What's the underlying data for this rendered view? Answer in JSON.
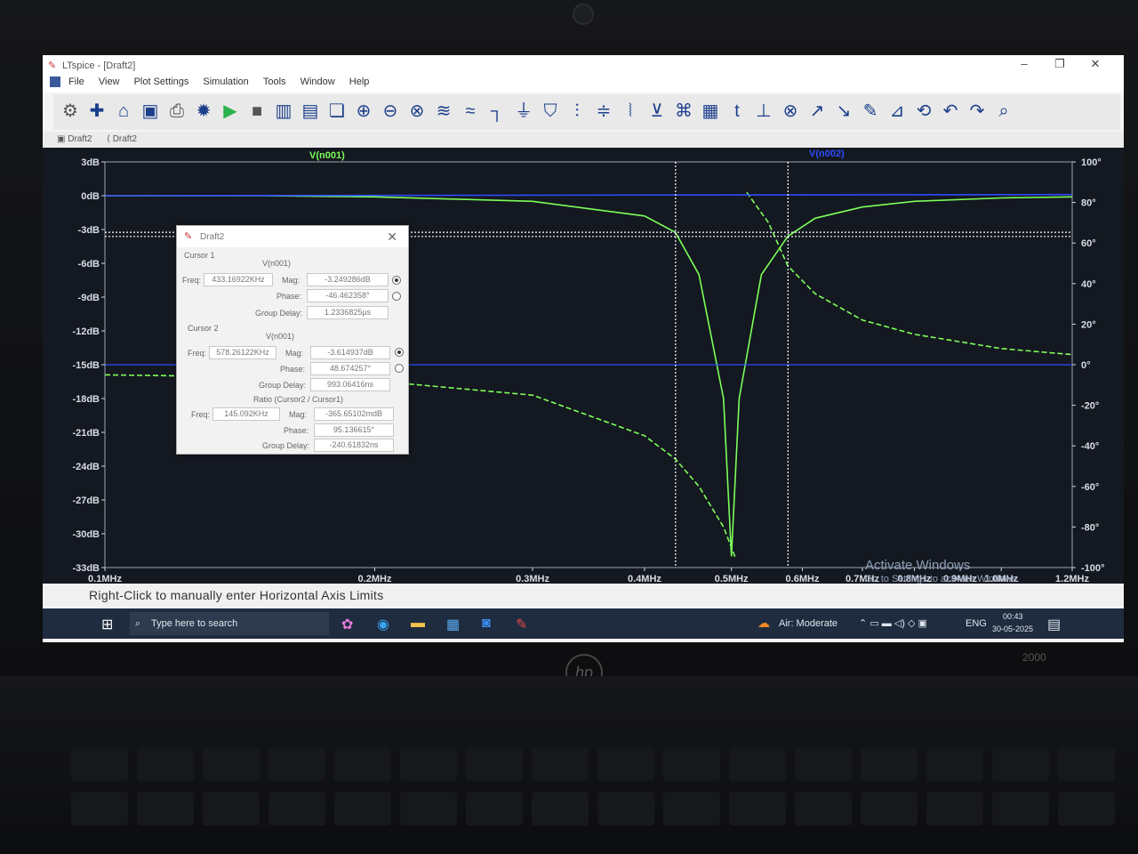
{
  "window": {
    "title": "LTspice - [Draft2]",
    "controls": [
      "–",
      "❐",
      "✕"
    ],
    "mdi_controls": [
      "–",
      "❐",
      "✕"
    ]
  },
  "menu": [
    "File",
    "View",
    "Plot Settings",
    "Simulation",
    "Tools",
    "Window",
    "Help"
  ],
  "toolbar_icons": [
    "settings-icon",
    "new-schematic-icon",
    "open-icon",
    "save-icon",
    "print-icon",
    "hierarchy-icon",
    "run-icon",
    "halt-icon",
    "tile-vertical-icon",
    "tile-horizontal-icon",
    "cascade-icon",
    "zoom-in-icon",
    "zoom-out-icon",
    "zoom-fit-icon",
    "autorange-icon",
    "scale-icon",
    "wire-icon",
    "ground-icon",
    "label-icon",
    "resistor-icon",
    "capacitor-icon",
    "inductor-icon",
    "diode-icon",
    "component-icon",
    "net-icon",
    "text-icon",
    "spice-directive-icon",
    "delete-icon",
    "move-icon",
    "drag-icon",
    "draw-icon",
    "mirror-icon",
    "rotate-icon",
    "undo-icon",
    "redo-icon",
    "find-icon"
  ],
  "tabs": [
    "Draft2",
    "Draft2"
  ],
  "plot": {
    "trace1_label": "V(n001)",
    "trace2_label": "V(n002)",
    "trace1_color": "#7cff5a",
    "trace2_color": "#2e4bff",
    "left_ticks": [
      "3dB",
      "0dB",
      "-3dB",
      "-6dB",
      "-9dB",
      "-12dB",
      "-15dB",
      "-18dB",
      "-21dB",
      "-24dB",
      "-27dB",
      "-30dB",
      "-33dB"
    ],
    "right_ticks": [
      "100°",
      "80°",
      "60°",
      "40°",
      "20°",
      "0°",
      "-20°",
      "-40°",
      "-60°",
      "-80°",
      "-100°"
    ],
    "x_ticks": [
      "0.1MHz",
      "0.2MHz",
      "0.3MHz",
      "0.4MHz",
      "0.5MHz",
      "0.6MHz",
      "0.7MHz",
      "0.8MHz",
      "0.9MHz",
      "1.0MHz",
      "1.2MHz"
    ],
    "watermark_title": "Activate Windows",
    "watermark_sub": "Go to Settings to activate Windows."
  },
  "chart_data": {
    "type": "line",
    "title": "",
    "xlabel": "",
    "ylabel": "",
    "x_scale": "log",
    "xlim_hz": [
      100000,
      1200000
    ],
    "ylim_db": [
      -33,
      3
    ],
    "y2lim_deg": [
      -100,
      100
    ],
    "series": [
      {
        "name": "V(n001)",
        "axis": "magnitude_db",
        "style": "solid",
        "x_hz": [
          100000,
          150000,
          200000,
          300000,
          400000,
          433000,
          460000,
          490000,
          500000,
          510000,
          540000,
          578000,
          620000,
          700000,
          800000,
          1000000,
          1200000
        ],
        "y": [
          0,
          0,
          -0.1,
          -0.5,
          -1.8,
          -3.25,
          -7,
          -18,
          -32,
          -18,
          -7,
          -3.6,
          -2,
          -1,
          -0.5,
          -0.2,
          -0.1
        ]
      },
      {
        "name": "V(n001)",
        "axis": "phase_deg",
        "style": "dashed",
        "x_hz": [
          100000,
          150000,
          200000,
          300000,
          400000,
          433000,
          460000,
          490000,
          505000,
          520000,
          550000,
          578000,
          620000,
          700000,
          800000,
          1000000,
          1200000
        ],
        "y": [
          -5,
          -6,
          -8,
          -15,
          -35,
          -46.5,
          -60,
          -80,
          -95,
          85,
          70,
          48.7,
          35,
          22,
          15,
          8,
          5
        ]
      },
      {
        "name": "V(n002)",
        "axis": "magnitude_db",
        "style": "solid",
        "x_hz": [
          100000,
          1200000
        ],
        "y": [
          0,
          0.1
        ]
      }
    ]
  },
  "cursors": {
    "dialog_title": "Draft2",
    "cursor1_header": "Cursor 1",
    "cursor1_trace": "V(n001)",
    "cursor1_freq": "433.16922KHz",
    "cursor1_mag": "-3.249286dB",
    "cursor1_phase": "-46.462358°",
    "cursor1_gd": "1.2336825µs",
    "cursor2_header": "Cursor 2",
    "cursor2_trace": "V(n001)",
    "cursor2_freq": "578.26122KHz",
    "cursor2_mag": "-3.614937dB",
    "cursor2_phase": "48.674257°",
    "cursor2_gd": "993.06416ns",
    "ratio_header": "Ratio (Cursor2 / Cursor1)",
    "ratio_freq": "145.092KHz",
    "ratio_mag": "-365.65102mdB",
    "ratio_phase": "95.136615°",
    "ratio_gd": "-240.61832ns",
    "labels": {
      "freq": "Freq:",
      "mag": "Mag:",
      "phase": "Phase:",
      "gd": "Group Delay:"
    }
  },
  "status_text": "Right-Click to manually enter Horizontal Axis Limits",
  "taskbar": {
    "search_placeholder": "Type here to search",
    "weather": "Air: Moderate",
    "lang": "ENG",
    "time": "00:43",
    "date": "30-05-2025"
  },
  "laptop": {
    "brand": "hp",
    "model": "2000"
  }
}
